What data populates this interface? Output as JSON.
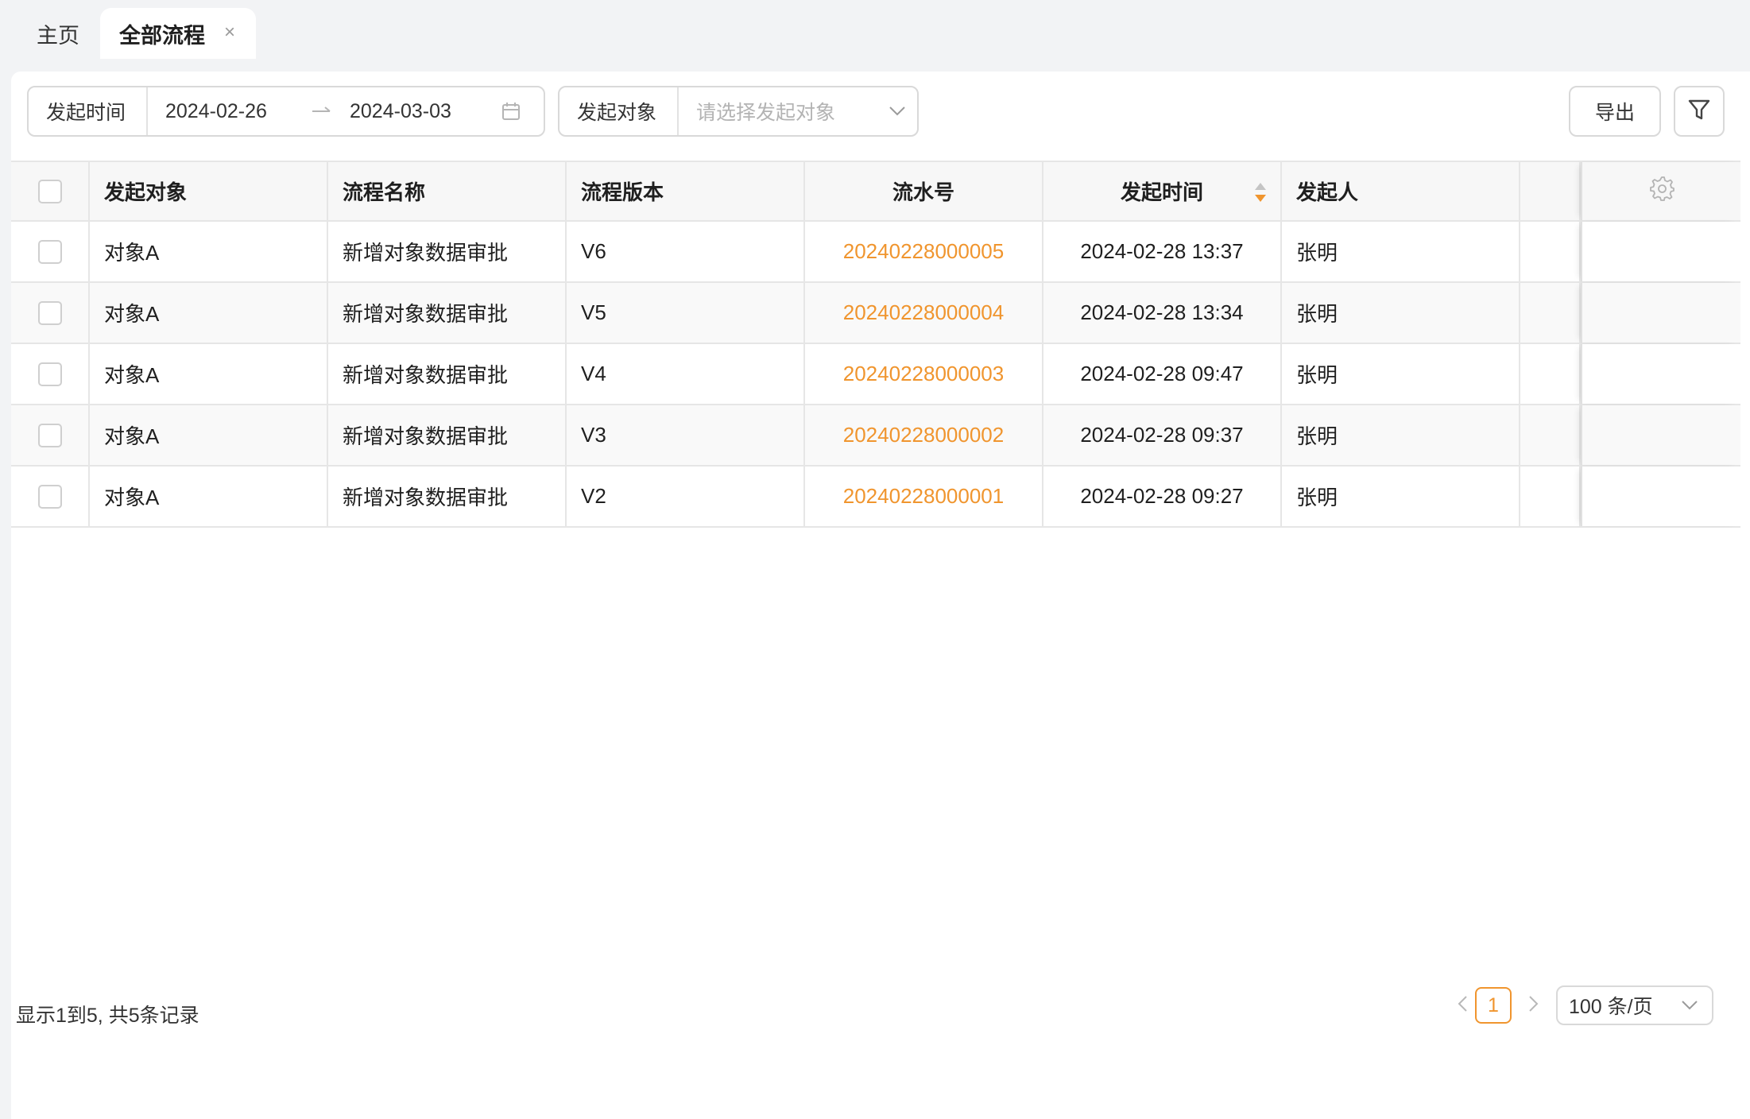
{
  "tabs": {
    "home": "主页",
    "active": "全部流程",
    "close": "×"
  },
  "filters": {
    "time_label": "发起时间",
    "date_start": "2024-02-26",
    "date_end": "2024-03-03",
    "target_label": "发起对象",
    "target_placeholder": "请选择发起对象"
  },
  "toolbar": {
    "export_label": "导出"
  },
  "table": {
    "headers": [
      "发起对象",
      "流程名称",
      "流程版本",
      "流水号",
      "发起时间",
      "发起人"
    ],
    "rows": [
      {
        "target": "对象A",
        "name": "新增对象数据审批",
        "version": "V6",
        "serial": "20240228000005",
        "time": "2024-02-28 13:37",
        "initiator": "张明"
      },
      {
        "target": "对象A",
        "name": "新增对象数据审批",
        "version": "V5",
        "serial": "20240228000004",
        "time": "2024-02-28 13:34",
        "initiator": "张明"
      },
      {
        "target": "对象A",
        "name": "新增对象数据审批",
        "version": "V4",
        "serial": "20240228000003",
        "time": "2024-02-28 09:47",
        "initiator": "张明"
      },
      {
        "target": "对象A",
        "name": "新增对象数据审批",
        "version": "V3",
        "serial": "20240228000002",
        "time": "2024-02-28 09:37",
        "initiator": "张明"
      },
      {
        "target": "对象A",
        "name": "新增对象数据审批",
        "version": "V2",
        "serial": "20240228000001",
        "time": "2024-02-28 09:27",
        "initiator": "张明"
      }
    ]
  },
  "footer": {
    "summary": "显示1到5, 共5条记录",
    "current_page": "1",
    "page_size": "100 条/页"
  },
  "colors": {
    "accent": "#f0952e",
    "border": "#d9d9d9",
    "background": "#f2f3f5"
  },
  "icons": {
    "tab_close": "close-icon",
    "date_separator": "arrow-right-icon",
    "calendar": "calendar-icon",
    "select_chevron": "chevron-down-icon",
    "filter": "filter-icon",
    "sort": "sort-icon",
    "column_settings": "gear-icon",
    "prev_page": "chevron-left-icon",
    "next_page": "chevron-right-icon"
  }
}
